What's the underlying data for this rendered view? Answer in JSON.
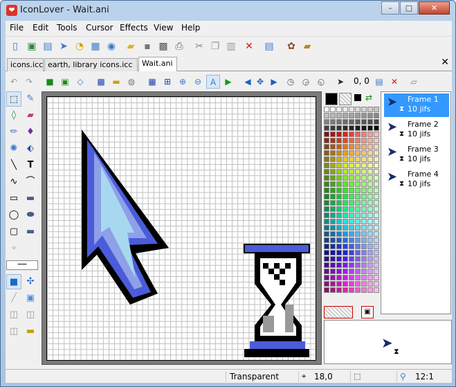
{
  "window": {
    "title": "IconLover - Wait.ani",
    "app_icon": "❤"
  },
  "window_buttons": {
    "minimize": "–",
    "maximize": "□",
    "close": "✕"
  },
  "menu": [
    "File",
    "Edit",
    "Tools",
    "Cursor",
    "Effects",
    "View",
    "Help"
  ],
  "toolbar": [
    "new-file-icon",
    "new-icon-icon",
    "new-library-icon",
    "new-cursor-icon",
    "new-animated-cursor-icon",
    "new-image-icon",
    "open-folder-icon",
    "save-icon",
    "save-all-icon",
    "print-icon",
    "cut-icon",
    "copy-icon",
    "paste-icon",
    "delete-icon",
    "properties-icon",
    "extract-icon",
    "library-icon"
  ],
  "tabs": [
    "icons.icc",
    "earth, library icons.icc",
    "Wait.ani"
  ],
  "active_tab": "Wait.ani",
  "coordinate_readout": "0, 0",
  "frames": [
    {
      "label": "Frame 1",
      "delay": "10 jifs"
    },
    {
      "label": "Frame 2",
      "delay": "10 jifs"
    },
    {
      "label": "Frame 3",
      "delay": "10 jifs"
    },
    {
      "label": "Frame 4",
      "delay": "10 jifs"
    }
  ],
  "selected_frame": "Frame 1",
  "status": {
    "color": "Transparent",
    "position": "18,0",
    "zoom": "12:1"
  },
  "colors": {
    "accent": "#3399ff",
    "cursor_blue": "#4a5cd9",
    "cursor_light": "#a8d8f0"
  }
}
